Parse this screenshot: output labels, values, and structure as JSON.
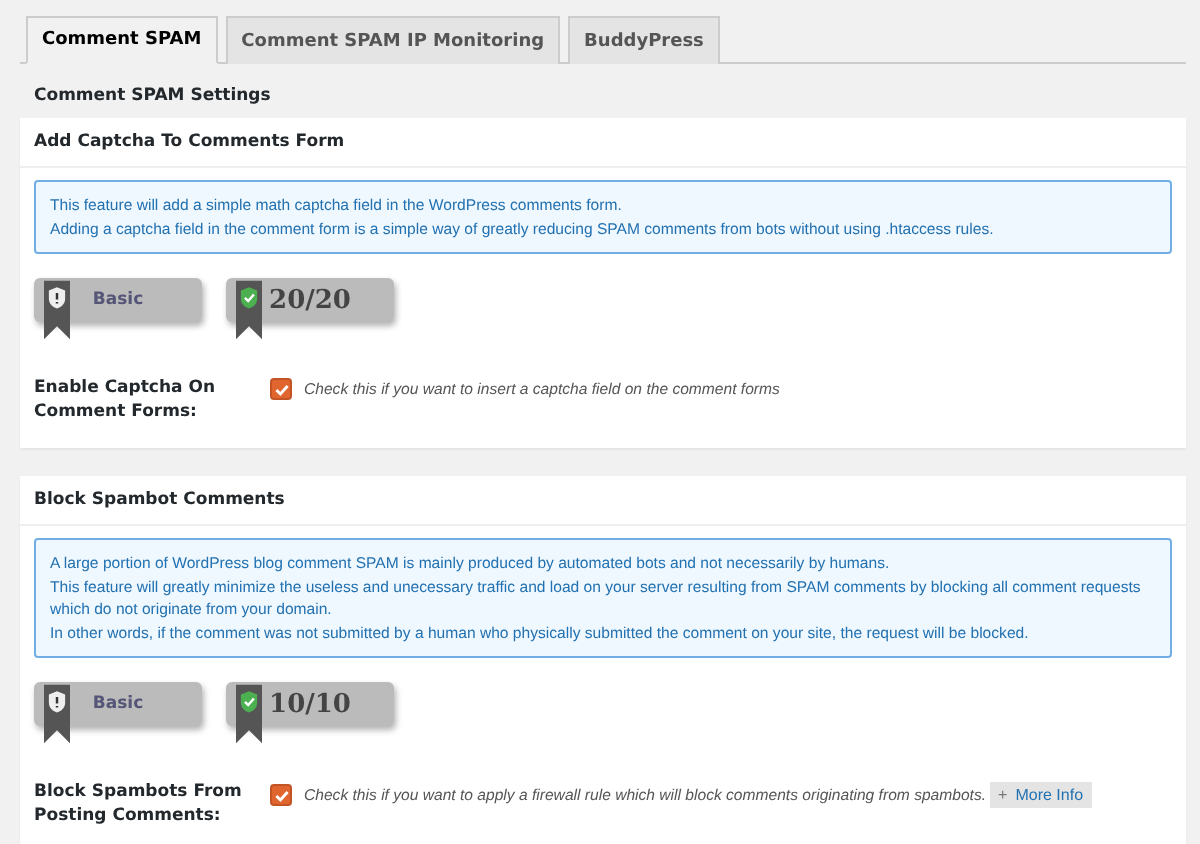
{
  "tabs": [
    {
      "label": "Comment SPAM",
      "selected": true
    },
    {
      "label": "Comment SPAM IP Monitoring",
      "selected": false
    },
    {
      "label": "BuddyPress",
      "selected": false
    }
  ],
  "settings_heading": "Comment SPAM Settings",
  "panels": [
    {
      "title": "Add Captcha To Comments Form",
      "info": [
        "This feature will add a simple math captcha field in the WordPress comments form.",
        "Adding a captcha field in the comment form is a simple way of greatly reducing SPAM comments from bots without using .htaccess rules."
      ],
      "badges": [
        {
          "kind": "level",
          "text": "Basic"
        },
        {
          "kind": "score",
          "text": "20/20"
        }
      ],
      "option": {
        "label": "Enable Captcha On Comment Forms:",
        "checked": true,
        "description": "Check this if you want to insert a captcha field on the comment forms"
      }
    },
    {
      "title": "Block Spambot Comments",
      "info": [
        "A large portion of WordPress blog comment SPAM is mainly produced by automated bots and not necessarily by humans.",
        "This feature will greatly minimize the useless and unecessary traffic and load on your server resulting from SPAM comments by blocking all comment requests which do not originate from your domain.",
        "In other words, if the comment was not submitted by a human who physically submitted the comment on your site, the request will be blocked."
      ],
      "badges": [
        {
          "kind": "level",
          "text": "Basic"
        },
        {
          "kind": "score",
          "text": "10/10"
        }
      ],
      "option": {
        "label": "Block Spambots From Posting Comments:",
        "checked": true,
        "description": "Check this if you want to apply a firewall rule which will block comments originating from spambots.",
        "more_info": "More Info",
        "more_info_icon": "+"
      }
    }
  ]
}
